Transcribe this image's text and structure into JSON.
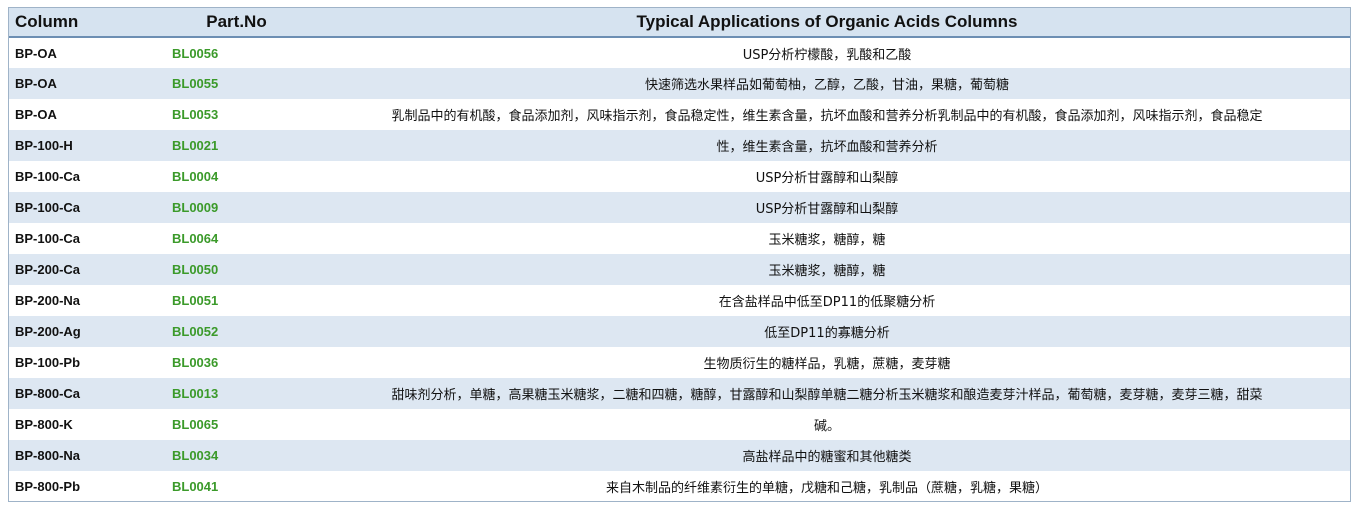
{
  "table": {
    "headers": {
      "column": "Column",
      "part_no": "Part.No",
      "applications": "Typical Applications of Organic Acids Columns"
    },
    "rows": [
      {
        "column": "BP-OA",
        "part_no": "BL0056",
        "application": "USP分析柠檬酸，乳酸和乙酸"
      },
      {
        "column": "BP-OA",
        "part_no": "BL0055",
        "application": "快速筛选水果样品如葡萄柚，乙醇，乙酸，甘油，果糖，葡萄糖"
      },
      {
        "column": "BP-OA",
        "part_no": "BL0053",
        "application": "乳制品中的有机酸，食品添加剂，风味指示剂，食品稳定性，维生素含量，抗坏血酸和营养分析乳制品中的有机酸，食品添加剂，风味指示剂，食品稳定"
      },
      {
        "column": "BP-100-H",
        "part_no": "BL0021",
        "application": "性，维生素含量，抗坏血酸和营养分析"
      },
      {
        "column": "BP-100-Ca",
        "part_no": "BL0004",
        "application": "USP分析甘露醇和山梨醇"
      },
      {
        "column": "BP-100-Ca",
        "part_no": "BL0009",
        "application": "USP分析甘露醇和山梨醇"
      },
      {
        "column": "BP-100-Ca",
        "part_no": "BL0064",
        "application": "玉米糖浆，糖醇，糖"
      },
      {
        "column": "BP-200-Ca",
        "part_no": "BL0050",
        "application": "玉米糖浆，糖醇，糖"
      },
      {
        "column": "BP-200-Na",
        "part_no": "BL0051",
        "application": "在含盐样品中低至DP11的低聚糖分析"
      },
      {
        "column": "BP-200-Ag",
        "part_no": "BL0052",
        "application": "低至DP11的寡糖分析"
      },
      {
        "column": "BP-100-Pb",
        "part_no": "BL0036",
        "application": "生物质衍生的糖样品，乳糖，蔗糖，麦芽糖"
      },
      {
        "column": "BP-800-Ca",
        "part_no": "BL0013",
        "application": "甜味剂分析，单糖，高果糖玉米糖浆，二糖和四糖，糖醇，甘露醇和山梨醇单糖二糖分析玉米糖浆和酿造麦芽汁样品，葡萄糖，麦芽糖，麦芽三糖，甜菜"
      },
      {
        "column": "BP-800-K",
        "part_no": "BL0065",
        "application": "碱。"
      },
      {
        "column": "BP-800-Na",
        "part_no": "BL0034",
        "application": "高盐样品中的糖蜜和其他糖类"
      },
      {
        "column": "BP-800-Pb",
        "part_no": "BL0041",
        "application": "来自木制品的纤维素衍生的单糖，戊糖和己糖，乳制品（蔗糖，乳糖，果糖）"
      }
    ]
  }
}
